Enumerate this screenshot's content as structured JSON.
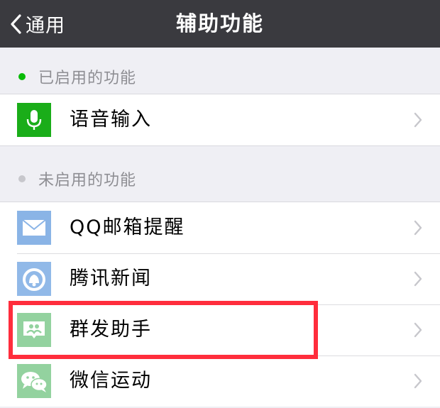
{
  "navbar": {
    "back_label": "通用",
    "title": "辅助功能"
  },
  "enabled_section": {
    "label": "已启用的功能",
    "dot_color": "#09bb07",
    "items": [
      {
        "label": "语音输入",
        "icon": "microphone-icon",
        "icon_bg": "#1aad19"
      }
    ]
  },
  "disabled_section": {
    "label": "未启用的功能",
    "dot_color": "#c7c7cc",
    "items": [
      {
        "label": "QQ邮箱提醒",
        "icon": "mail-icon",
        "icon_bg": "#8ab4e6"
      },
      {
        "label": "腾讯新闻",
        "icon": "tencent-news-icon",
        "icon_bg": "#91b9e8"
      },
      {
        "label": "群发助手",
        "icon": "group-message-icon",
        "icon_bg": "#93d29f"
      },
      {
        "label": "微信运动",
        "icon": "wechat-sport-icon",
        "icon_bg": "#93d29f"
      }
    ]
  },
  "highlight_color": "#ff2d3c"
}
